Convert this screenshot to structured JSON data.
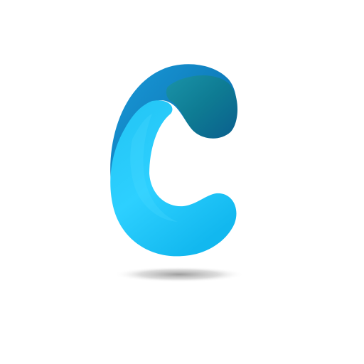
{
  "logo": {
    "letter": "C",
    "colors": {
      "front_light": "#2ed0ff",
      "front_mid": "#18b8f0",
      "back_dark": "#0b6fb0",
      "back_mid": "#1591d2",
      "inner_teal": "#0f7e9a",
      "shadow": "#9a9a9a",
      "background": "#ffffff"
    }
  }
}
